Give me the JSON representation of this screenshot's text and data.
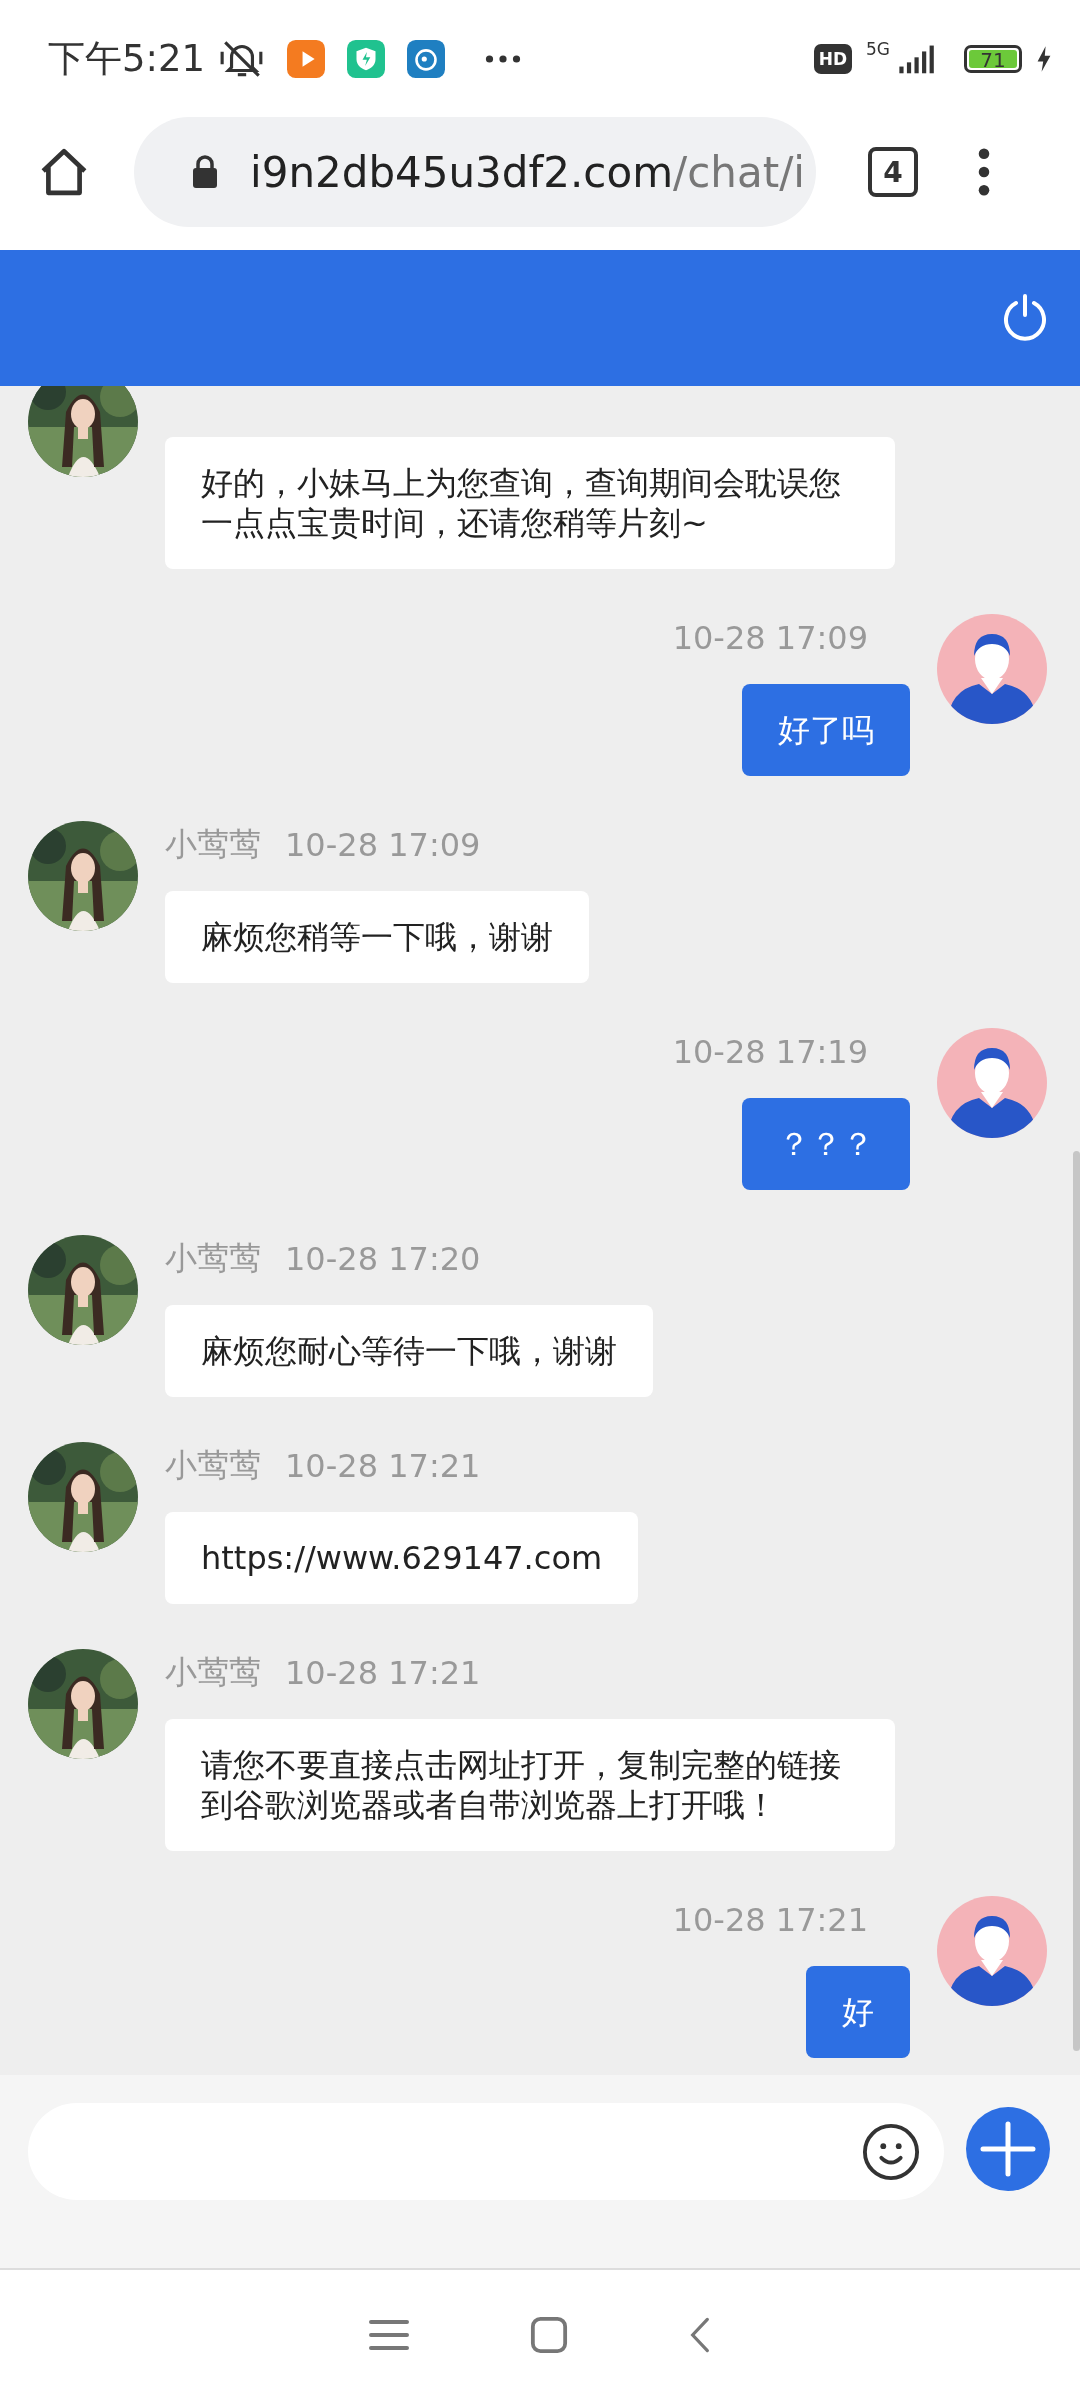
{
  "status_bar": {
    "time": "下午5:21",
    "hd_badge": "HD",
    "network": "5G",
    "battery": "71",
    "charging": true
  },
  "browser": {
    "url_host": "i9n2db45u3df2.com",
    "url_path": "/chat/i",
    "tab_count": "4"
  },
  "messages": [
    {
      "kind": "left",
      "text": "好的，小妹马上为您查询，查询期间会耽误您一点点宝贵时间，还请您稍等片刻~"
    },
    {
      "kind": "right",
      "time": "10-28 17:09",
      "text": "好了吗"
    },
    {
      "kind": "left",
      "sender": "小莺莺",
      "time": "10-28 17:09",
      "text": "麻烦您稍等一下哦，谢谢"
    },
    {
      "kind": "right",
      "time": "10-28 17:19",
      "text": "？？？"
    },
    {
      "kind": "left",
      "sender": "小莺莺",
      "time": "10-28 17:20",
      "text": "麻烦您耐心等待一下哦，谢谢"
    },
    {
      "kind": "left",
      "sender": "小莺莺",
      "time": "10-28 17:21",
      "text": "https://www.629147.com"
    },
    {
      "kind": "left",
      "sender": "小莺莺",
      "time": "10-28 17:21",
      "text": "请您不要直接点击网址打开，复制完整的链接到谷歌浏览器或者自带浏览器上打开哦！"
    },
    {
      "kind": "right",
      "time": "10-28 17:21",
      "text": "好"
    }
  ]
}
